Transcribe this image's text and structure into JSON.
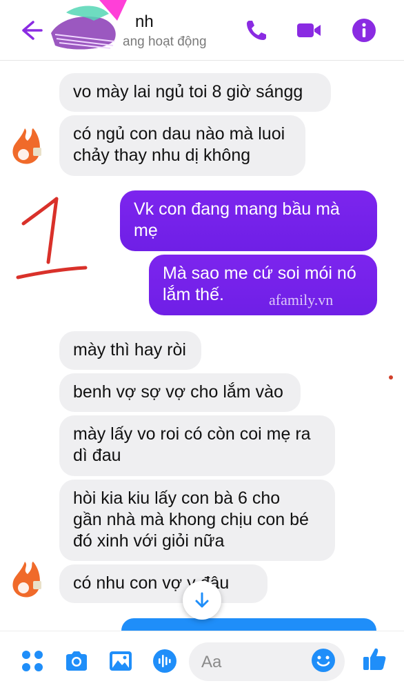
{
  "header": {
    "contact_name": "nh",
    "status": "ang hoạt động",
    "icons": [
      "back-arrow-icon",
      "phone-icon",
      "video-call-icon",
      "info-icon"
    ]
  },
  "messages": [
    {
      "side": "in",
      "text": "vo mày   lai ngủ toi 8 giờ sángg"
    },
    {
      "side": "in",
      "text": "có ngủ con dau nào mà luoi\nchảy thay  nhu  dị không"
    },
    {
      "side": "out",
      "text": "Vk con đang mang bầu mà\nmẹ"
    },
    {
      "side": "out",
      "text": "Mà sao me cứ soi mói nó\nlắm thế."
    },
    {
      "side": "in",
      "text": "mày thì hay ròi"
    },
    {
      "side": "in",
      "text": "benh vợ sợ  vợ cho lắm vào"
    },
    {
      "side": "in",
      "text": "mày lấy vo roi có còn coi mẹ ra\ndì đau"
    },
    {
      "side": "in",
      "text": "hòi kia kiu lấy  con  bà 6 cho\ngần nhà mà khong chịu con bé\nđó xinh với giỏi nữa"
    },
    {
      "side": "in",
      "text": "có nhu con vợ     y đâu"
    }
  ],
  "watermark": "afamily.vn",
  "composer": {
    "placeholder": "Aa",
    "icons": [
      "apps-icon",
      "camera-icon",
      "gallery-icon",
      "voice-icon",
      "emoji-icon",
      "like-icon"
    ]
  },
  "colors": {
    "accent": "#7b22ec",
    "incoming_bubble": "#efeff1",
    "outgoing_bubble": "#7b22ec",
    "composer_icon": "#1f8ef9"
  }
}
